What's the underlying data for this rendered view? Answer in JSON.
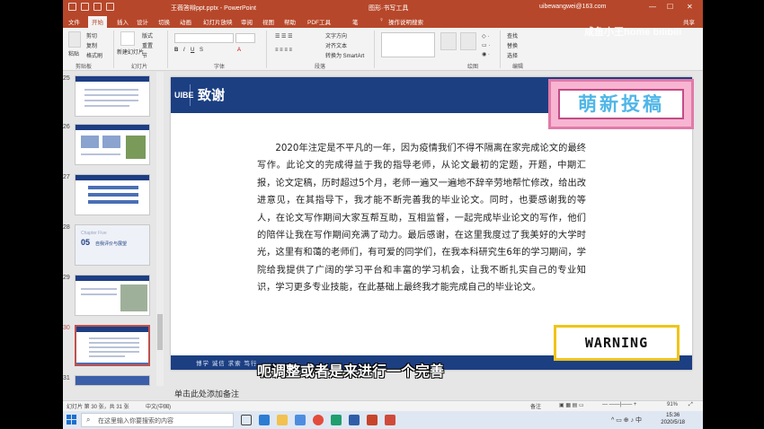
{
  "titlebar": {
    "filename": "王薇答辩ppt.pptx - PowerPoint",
    "context_tool": "图形·书写工具",
    "account": "uibewangwei@163.com",
    "win_min": "—",
    "win_max": "☐",
    "win_close": "✕"
  },
  "tabs": [
    "文件",
    "开始",
    "插入",
    "设计",
    "切换",
    "动画",
    "幻灯片放映",
    "审阅",
    "视图",
    "帮助",
    "PDF工具",
    "笔"
  ],
  "tell_me": "操作说明搜索",
  "share": "共享",
  "ribbon": {
    "clipboard": {
      "paste": "粘贴",
      "cut": "剪切",
      "copy": "复制",
      "format_painter": "格式刷",
      "label": "剪贴板"
    },
    "slides": {
      "new_slide": "新建幻灯片",
      "layout": "版式",
      "reset": "重置",
      "section": "节",
      "label": "幻灯片"
    },
    "font": {
      "label": "字体"
    },
    "paragraph": {
      "text_direction": "文字方向",
      "align_text": "对齐文本",
      "smartart": "转换为 SmartArt",
      "label": "段落"
    },
    "drawing": {
      "label": "绘图"
    },
    "editing": {
      "find": "查找",
      "replace": "替换",
      "select": "选择",
      "label": "编辑"
    }
  },
  "thumbnails": {
    "items": [
      {
        "num": "25",
        "selected": false
      },
      {
        "num": "26",
        "selected": false
      },
      {
        "num": "27",
        "selected": false
      },
      {
        "num": "28",
        "selected": false,
        "chapter": "Chapter Five",
        "chapter_num": "05",
        "chapter_title": "自我评价与展望"
      },
      {
        "num": "29",
        "selected": false
      },
      {
        "num": "30",
        "selected": true
      },
      {
        "num": "31",
        "selected": false
      }
    ]
  },
  "slide": {
    "logo": "UIBE",
    "title": "致谢",
    "body": "2020年注定是不平凡的一年，因为疫情我们不得不隔离在家完成论文的最终写作。此论文的完成得益于我的指导老师，从论文最初的定题，开题，中期汇报，论文定稿，历时超过5个月，老师一遍又一遍地不辞辛劳地帮忙修改，给出改进意见，在其指导下，我才能不断完善我的毕业论文。同时，也要感谢我的等人，在论文写作期间大家互帮互助，互相监督，一起完成毕业论文的写作，他们的陪伴让我在写作期间充满了动力。最后感谢，在这里我度过了我美好的大学时光，这里有和蔼的老师们，有可爱的同学们，在我本科研究生6年的学习期间，学院给我提供了广阔的学习平台和丰富的学习机会，让我不断扎实自己的专业知识，学习更多专业技能，在此基础上最终我才能完成自己的毕业论文。",
    "footer": "博学 诚信 求索 笃行"
  },
  "sticker": {
    "text": "萌新投稿"
  },
  "warning": {
    "text": "WARNING"
  },
  "notes": {
    "placeholder": "单击此处添加备注"
  },
  "statusbar": {
    "slide_info": "幻灯片 第 30 张，共 31 张",
    "language": "中文(中国)",
    "notes_btn": "备注",
    "zoom": "91%"
  },
  "taskbar": {
    "search_placeholder": "在这里输入你要搜索的内容",
    "time": "15:36",
    "date": "2020/5/18"
  },
  "subtitle": "呃调整或者是来进行一个完善",
  "watermark": "咸鱼小王home  bilibili",
  "colors": {
    "ppt_accent": "#b7472a",
    "slide_blue": "#1c3f82",
    "sticker_pink": "#f7b5d2",
    "warning_yellow": "#f0c419"
  }
}
